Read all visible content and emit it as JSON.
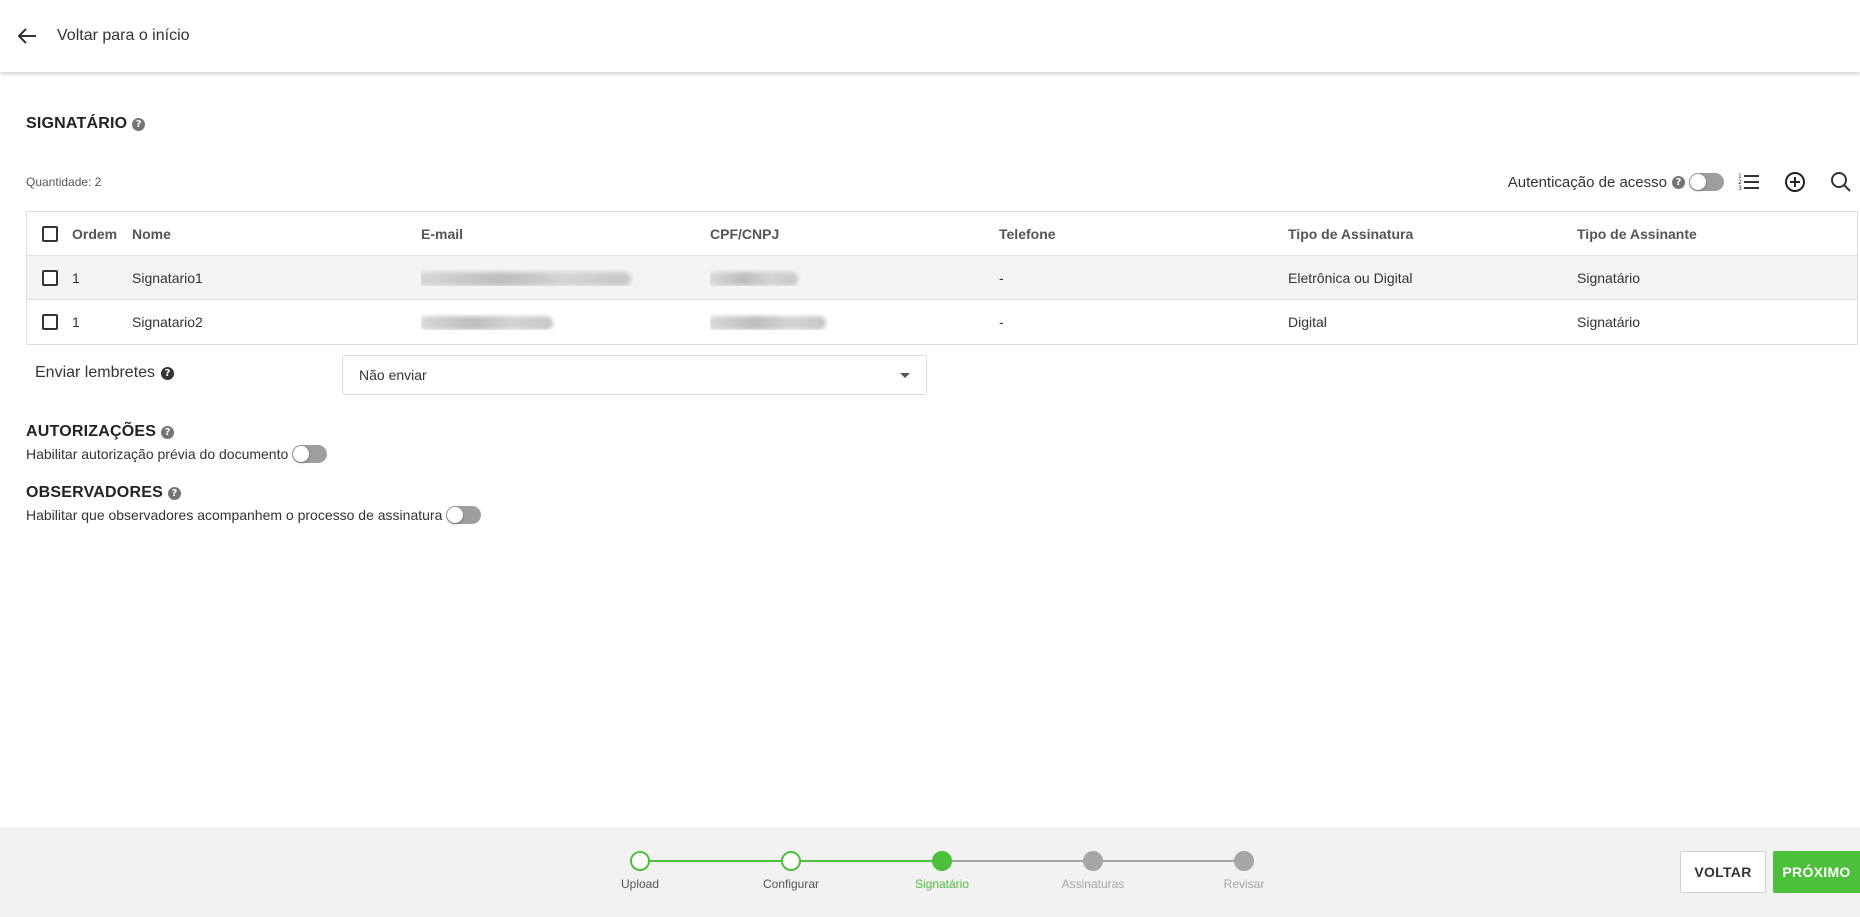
{
  "header": {
    "back_label": "Voltar para o início"
  },
  "signatario": {
    "title": "SIGNATÁRIO",
    "help": "?",
    "quantity": "Quantidade: 2",
    "auth_label": "Autenticação de acesso",
    "table": {
      "columns": [
        "Ordem",
        "Nome",
        "E-mail",
        "CPF/CNPJ",
        "Telefone",
        "Tipo de Assinatura",
        "Tipo de Assinante"
      ],
      "rows": [
        {
          "ordem": "1",
          "nome": "Signatario1",
          "telefone": "-",
          "tipo_assinatura": "Eletrônica ou Digital",
          "tipo_assinante": "Signatário"
        },
        {
          "ordem": "1",
          "nome": "Signatario2",
          "telefone": "-",
          "tipo_assinatura": "Digital",
          "tipo_assinante": "Signatário"
        }
      ]
    }
  },
  "reminders": {
    "label": "Enviar lembretes",
    "selected": "Não enviar"
  },
  "autorizacoes": {
    "title": "AUTORIZAÇÕES",
    "toggle_label": "Habilitar autorização prévia do documento"
  },
  "observadores": {
    "title": "OBSERVADORES",
    "toggle_label": "Habilitar que observadores acompanhem o processo de assinatura"
  },
  "stepper": {
    "steps": [
      {
        "label": "Upload",
        "state": "done"
      },
      {
        "label": "Configurar",
        "state": "done"
      },
      {
        "label": "Signatário",
        "state": "active"
      },
      {
        "label": "Assinaturas",
        "state": "pending"
      },
      {
        "label": "Revisar",
        "state": "pending"
      }
    ]
  },
  "footer": {
    "back_button": "VOLTAR",
    "next_button": "PRÓXIMO"
  },
  "colors": {
    "accent": "#4cbf3b",
    "pending": "#a6a6a6",
    "toggle_off": "#9e9e9e"
  }
}
